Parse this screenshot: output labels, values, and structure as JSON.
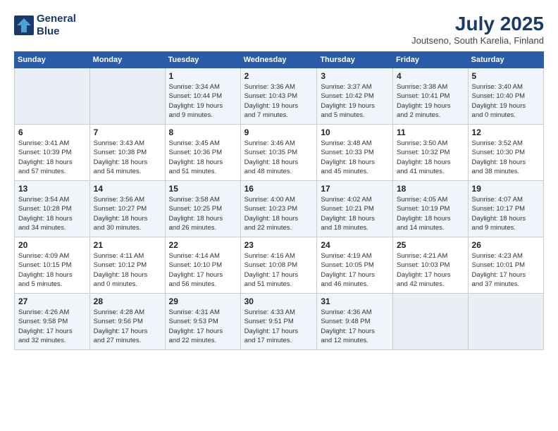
{
  "header": {
    "logo_line1": "General",
    "logo_line2": "Blue",
    "title": "July 2025",
    "subtitle": "Joutseno, South Karelia, Finland"
  },
  "days_of_week": [
    "Sunday",
    "Monday",
    "Tuesday",
    "Wednesday",
    "Thursday",
    "Friday",
    "Saturday"
  ],
  "weeks": [
    [
      {
        "day": "",
        "info": ""
      },
      {
        "day": "",
        "info": ""
      },
      {
        "day": "1",
        "info": "Sunrise: 3:34 AM\nSunset: 10:44 PM\nDaylight: 19 hours\nand 9 minutes."
      },
      {
        "day": "2",
        "info": "Sunrise: 3:36 AM\nSunset: 10:43 PM\nDaylight: 19 hours\nand 7 minutes."
      },
      {
        "day": "3",
        "info": "Sunrise: 3:37 AM\nSunset: 10:42 PM\nDaylight: 19 hours\nand 5 minutes."
      },
      {
        "day": "4",
        "info": "Sunrise: 3:38 AM\nSunset: 10:41 PM\nDaylight: 19 hours\nand 2 minutes."
      },
      {
        "day": "5",
        "info": "Sunrise: 3:40 AM\nSunset: 10:40 PM\nDaylight: 19 hours\nand 0 minutes."
      }
    ],
    [
      {
        "day": "6",
        "info": "Sunrise: 3:41 AM\nSunset: 10:39 PM\nDaylight: 18 hours\nand 57 minutes."
      },
      {
        "day": "7",
        "info": "Sunrise: 3:43 AM\nSunset: 10:38 PM\nDaylight: 18 hours\nand 54 minutes."
      },
      {
        "day": "8",
        "info": "Sunrise: 3:45 AM\nSunset: 10:36 PM\nDaylight: 18 hours\nand 51 minutes."
      },
      {
        "day": "9",
        "info": "Sunrise: 3:46 AM\nSunset: 10:35 PM\nDaylight: 18 hours\nand 48 minutes."
      },
      {
        "day": "10",
        "info": "Sunrise: 3:48 AM\nSunset: 10:33 PM\nDaylight: 18 hours\nand 45 minutes."
      },
      {
        "day": "11",
        "info": "Sunrise: 3:50 AM\nSunset: 10:32 PM\nDaylight: 18 hours\nand 41 minutes."
      },
      {
        "day": "12",
        "info": "Sunrise: 3:52 AM\nSunset: 10:30 PM\nDaylight: 18 hours\nand 38 minutes."
      }
    ],
    [
      {
        "day": "13",
        "info": "Sunrise: 3:54 AM\nSunset: 10:28 PM\nDaylight: 18 hours\nand 34 minutes."
      },
      {
        "day": "14",
        "info": "Sunrise: 3:56 AM\nSunset: 10:27 PM\nDaylight: 18 hours\nand 30 minutes."
      },
      {
        "day": "15",
        "info": "Sunrise: 3:58 AM\nSunset: 10:25 PM\nDaylight: 18 hours\nand 26 minutes."
      },
      {
        "day": "16",
        "info": "Sunrise: 4:00 AM\nSunset: 10:23 PM\nDaylight: 18 hours\nand 22 minutes."
      },
      {
        "day": "17",
        "info": "Sunrise: 4:02 AM\nSunset: 10:21 PM\nDaylight: 18 hours\nand 18 minutes."
      },
      {
        "day": "18",
        "info": "Sunrise: 4:05 AM\nSunset: 10:19 PM\nDaylight: 18 hours\nand 14 minutes."
      },
      {
        "day": "19",
        "info": "Sunrise: 4:07 AM\nSunset: 10:17 PM\nDaylight: 18 hours\nand 9 minutes."
      }
    ],
    [
      {
        "day": "20",
        "info": "Sunrise: 4:09 AM\nSunset: 10:15 PM\nDaylight: 18 hours\nand 5 minutes."
      },
      {
        "day": "21",
        "info": "Sunrise: 4:11 AM\nSunset: 10:12 PM\nDaylight: 18 hours\nand 0 minutes."
      },
      {
        "day": "22",
        "info": "Sunrise: 4:14 AM\nSunset: 10:10 PM\nDaylight: 17 hours\nand 56 minutes."
      },
      {
        "day": "23",
        "info": "Sunrise: 4:16 AM\nSunset: 10:08 PM\nDaylight: 17 hours\nand 51 minutes."
      },
      {
        "day": "24",
        "info": "Sunrise: 4:19 AM\nSunset: 10:05 PM\nDaylight: 17 hours\nand 46 minutes."
      },
      {
        "day": "25",
        "info": "Sunrise: 4:21 AM\nSunset: 10:03 PM\nDaylight: 17 hours\nand 42 minutes."
      },
      {
        "day": "26",
        "info": "Sunrise: 4:23 AM\nSunset: 10:01 PM\nDaylight: 17 hours\nand 37 minutes."
      }
    ],
    [
      {
        "day": "27",
        "info": "Sunrise: 4:26 AM\nSunset: 9:58 PM\nDaylight: 17 hours\nand 32 minutes."
      },
      {
        "day": "28",
        "info": "Sunrise: 4:28 AM\nSunset: 9:56 PM\nDaylight: 17 hours\nand 27 minutes."
      },
      {
        "day": "29",
        "info": "Sunrise: 4:31 AM\nSunset: 9:53 PM\nDaylight: 17 hours\nand 22 minutes."
      },
      {
        "day": "30",
        "info": "Sunrise: 4:33 AM\nSunset: 9:51 PM\nDaylight: 17 hours\nand 17 minutes."
      },
      {
        "day": "31",
        "info": "Sunrise: 4:36 AM\nSunset: 9:48 PM\nDaylight: 17 hours\nand 12 minutes."
      },
      {
        "day": "",
        "info": ""
      },
      {
        "day": "",
        "info": ""
      }
    ]
  ]
}
